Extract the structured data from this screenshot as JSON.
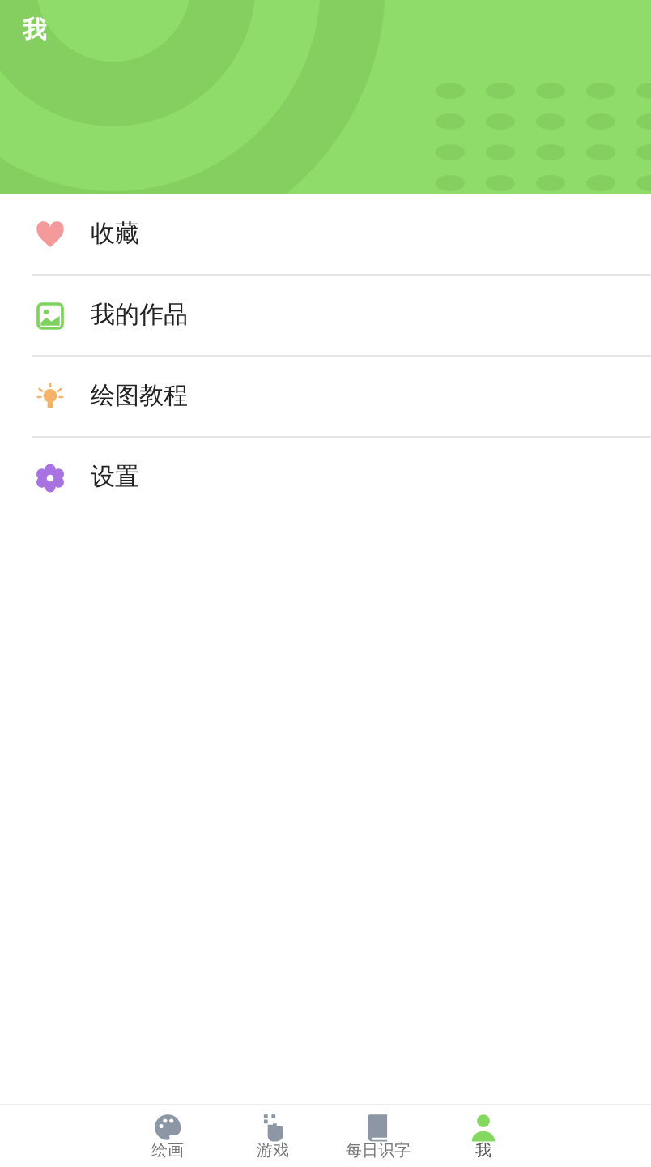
{
  "header": {
    "title": "我"
  },
  "menu": [
    {
      "kind": "heart",
      "label": "收藏"
    },
    {
      "kind": "picture",
      "label": "我的作品"
    },
    {
      "kind": "bulb",
      "label": "绘图教程"
    },
    {
      "kind": "gear",
      "label": "设置"
    }
  ],
  "tabs": [
    {
      "kind": "palette",
      "label": "绘画",
      "selected": false
    },
    {
      "kind": "hand",
      "label": "游戏",
      "selected": false
    },
    {
      "kind": "book",
      "label": "每日识字",
      "selected": false
    },
    {
      "kind": "person",
      "label": "我",
      "selected": true
    }
  ]
}
